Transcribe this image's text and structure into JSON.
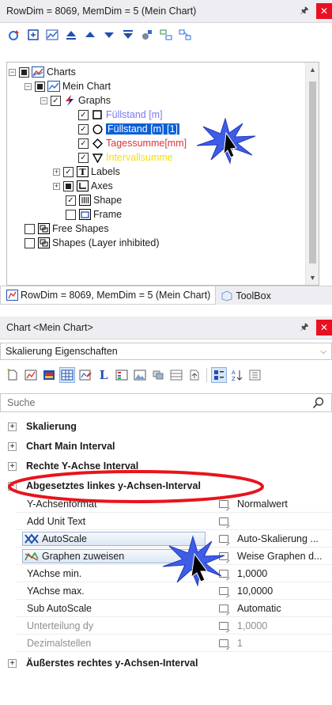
{
  "top_panel": {
    "title": "RowDim = 8069, MemDim = 5 (Mein Chart)",
    "pin": "⇨",
    "close": "×"
  },
  "tree": {
    "items": [
      {
        "label": "Charts"
      },
      {
        "label": "Mein Chart"
      },
      {
        "label": "Graphs"
      },
      {
        "label": "Füllstand [m]",
        "color": "#7a7af0"
      },
      {
        "label": "Füllstand [m] [1]",
        "color": "#ffffff"
      },
      {
        "label": "Tagessumme[mm]",
        "color": "#e0303a"
      },
      {
        "label": "Intervallsumme",
        "color": "#f2e200"
      },
      {
        "label": "Labels"
      },
      {
        "label": "Axes"
      },
      {
        "label": "Shape"
      },
      {
        "label": "Frame"
      },
      {
        "label": "Free Shapes"
      },
      {
        "label": "Shapes (Layer inhibited)"
      }
    ]
  },
  "tabs": [
    {
      "label": "RowDim = 8069, MemDim = 5 (Mein Chart)"
    },
    {
      "label": "ToolBox"
    }
  ],
  "bottom_panel": {
    "title": "Chart <Mein Chart>",
    "dropdown_value": "Skalierung Eigenschaften",
    "search_placeholder": "Suche"
  },
  "property_grid": {
    "categories": [
      {
        "label": "Skalierung",
        "sign": "+"
      },
      {
        "label": "Chart Main Interval",
        "sign": "+"
      },
      {
        "label": "Rechte Y-Achse Interval",
        "sign": "+"
      },
      {
        "label": "Abgesetztes linkes y-Achsen-Interval",
        "sign": "−"
      },
      {
        "label": "Äußerstes rechtes y-Achsen-Interval",
        "sign": "+"
      }
    ],
    "rows": [
      {
        "name": "Y-Achsenformat",
        "value": "Normalwert"
      },
      {
        "name": "Add Unit Text",
        "value": ""
      },
      {
        "name": "AutoScale",
        "value": "Auto-Skalierung ..."
      },
      {
        "name": "Graphen zuweisen",
        "value": "Weise Graphen d..."
      },
      {
        "name": "YAchse min.",
        "value": "1,0000"
      },
      {
        "name": "YAchse max.",
        "value": "10,0000"
      },
      {
        "name": "Sub AutoScale",
        "value": "Automatic"
      },
      {
        "name": "Unterteilung dy",
        "value": "1,0000"
      },
      {
        "name": "Dezimalstellen",
        "value": "1"
      }
    ]
  },
  "colors": {
    "selection": "#0a5fd6",
    "close_button": "#e81123",
    "highlight_ellipse": "#e8141c",
    "star_burst": "#3355e6"
  }
}
